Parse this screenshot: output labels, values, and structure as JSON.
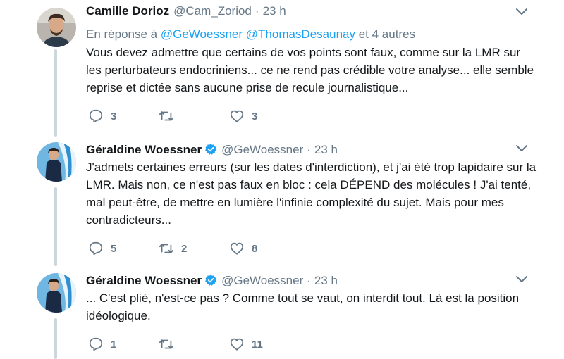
{
  "tweets": [
    {
      "name": "Camille Dorioz",
      "handle": "@Cam_Zoriod",
      "separator": "·",
      "time": "23 h",
      "verified": false,
      "reply": {
        "prefix": "En réponse à",
        "user1": "@GeWoessner",
        "user2": "@ThomasDesaunay",
        "suffix": "et 4 autres"
      },
      "text": "Vous devez admettre que certains de vos points sont faux, comme sur la LMR sur les perturbateurs endocriniens... ce ne rend pas crédible votre analyse... elle semble reprise et dictée sans aucune prise de recule journalistique...",
      "replies": "3",
      "retweets": "",
      "likes": "3"
    },
    {
      "name": "Géraldine Woessner",
      "handle": "@GeWoessner",
      "separator": "·",
      "time": "23 h",
      "verified": true,
      "text": "J'admets certaines erreurs (sur les dates d'interdiction), et j'ai été trop lapidaire sur la LMR. Mais non, ce n'est pas faux en bloc : cela DÉPEND des molécules ! J'ai tenté, mal peut-être, de mettre en lumière l'infinie complexité du sujet. Mais pour mes contradicteurs...",
      "replies": "5",
      "retweets": "2",
      "likes": "8"
    },
    {
      "name": "Géraldine Woessner",
      "handle": "@GeWoessner",
      "separator": "·",
      "time": "23 h",
      "verified": true,
      "text": "... C'est plié, n'est-ce pas ? Comme tout se vaut, on interdit tout. Là est la position idéologique.",
      "replies": "1",
      "retweets": "",
      "likes": "11"
    }
  ],
  "icons": {
    "reply": "reply-icon",
    "retweet": "retweet-icon",
    "like": "heart-icon",
    "more": "chevron-down-icon",
    "verified": "verified-badge-icon"
  },
  "colors": {
    "text": "#14171a",
    "secondary": "#657786",
    "link": "#1da1f2",
    "thread_line": "#ccd6dd",
    "verified": "#1da1f2"
  }
}
